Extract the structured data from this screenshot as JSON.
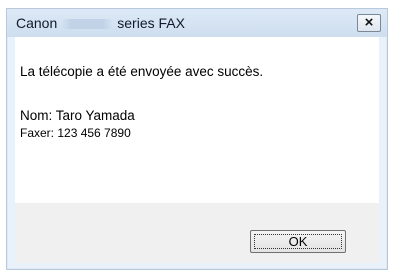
{
  "dialog": {
    "title_prefix": "Canon",
    "title_suffix": "series FAX",
    "close_symbol": "×",
    "message": "La télécopie a été envoyée avec succès.",
    "name_line": "Nom: Taro Yamada",
    "fax_line": "Faxer: 123 456 7890",
    "ok_label": "OK"
  },
  "icons": {
    "close": "close-icon"
  }
}
